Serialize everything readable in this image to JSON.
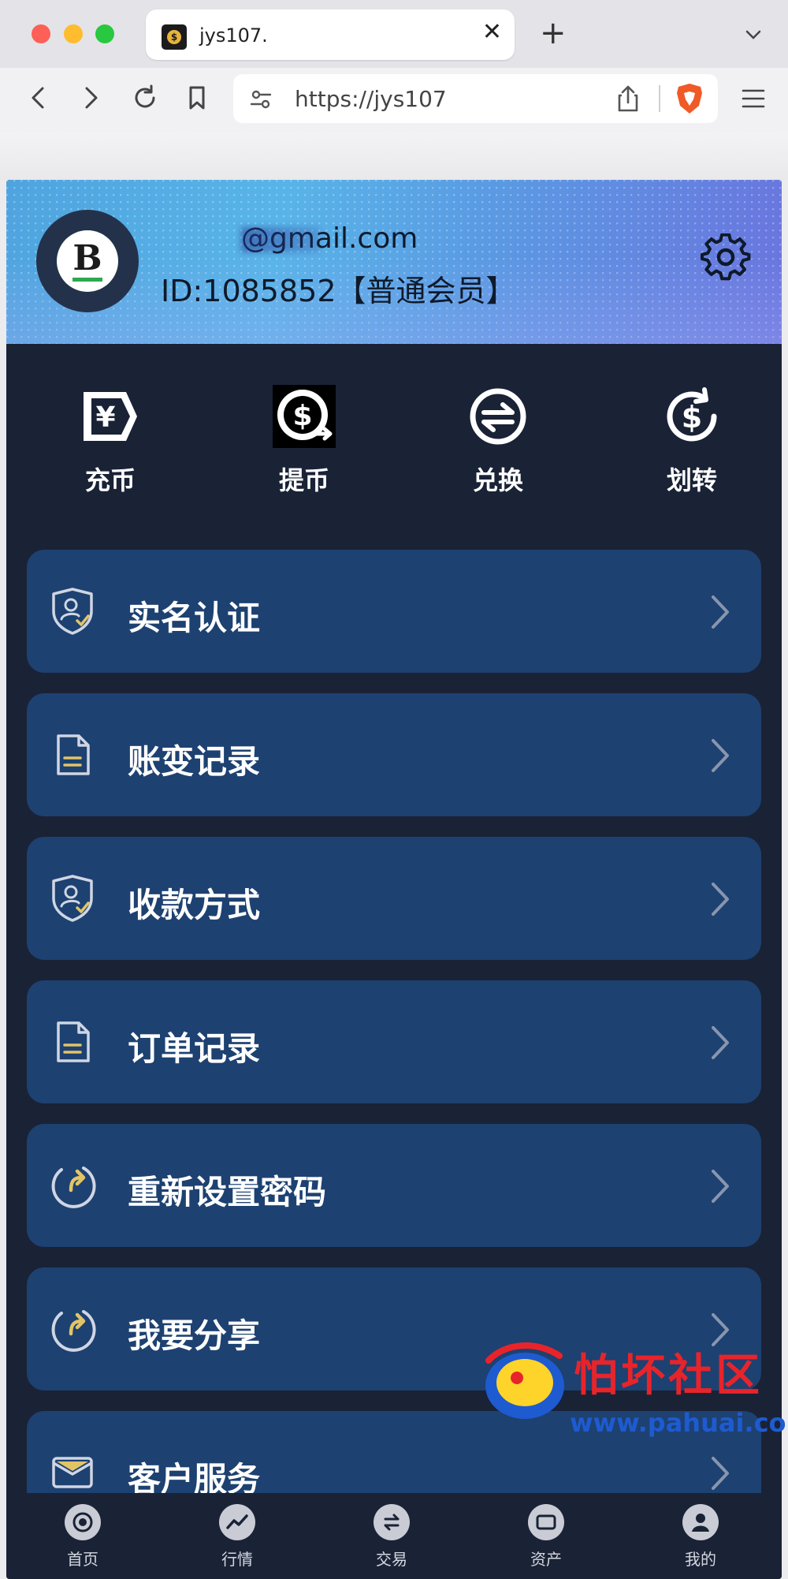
{
  "browser": {
    "tab_title": "jys107.",
    "tab_close": "✕",
    "new_tab": "+",
    "url": "https://jys107"
  },
  "profile": {
    "email": "@gmail.com",
    "uid": "ID:1085852【普通会员】"
  },
  "actions": [
    {
      "label": "充币",
      "icon": "deposit-icon"
    },
    {
      "label": "提币",
      "icon": "withdraw-icon"
    },
    {
      "label": "兑换",
      "icon": "exchange-icon"
    },
    {
      "label": "划转",
      "icon": "transfer-icon"
    }
  ],
  "menu": [
    {
      "label": "实名认证",
      "icon": "shield-user-icon"
    },
    {
      "label": "账变记录",
      "icon": "document-icon"
    },
    {
      "label": "收款方式",
      "icon": "shield-user-icon"
    },
    {
      "label": "订单记录",
      "icon": "document-icon"
    },
    {
      "label": "重新设置密码",
      "icon": "refresh-arrow-icon"
    },
    {
      "label": "我要分享",
      "icon": "refresh-arrow-icon"
    },
    {
      "label": "客户服务",
      "icon": "envelope-icon"
    }
  ],
  "bottom_nav": [
    {
      "label": "首页",
      "icon": "home-icon"
    },
    {
      "label": "行情",
      "icon": "chart-icon"
    },
    {
      "label": "交易",
      "icon": "trade-icon"
    },
    {
      "label": "资产",
      "icon": "wallet-icon"
    },
    {
      "label": "我的",
      "icon": "user-icon"
    }
  ],
  "watermark": {
    "text": "怕坏社区",
    "url": "www.pahuai.com"
  },
  "colors": {
    "app_bg": "#1a2236",
    "menu_item_bg": "#1d4171",
    "icon_accent": "#e2c468",
    "watermark_red": "#e8242b",
    "watermark_blue": "#1e5bd0"
  }
}
